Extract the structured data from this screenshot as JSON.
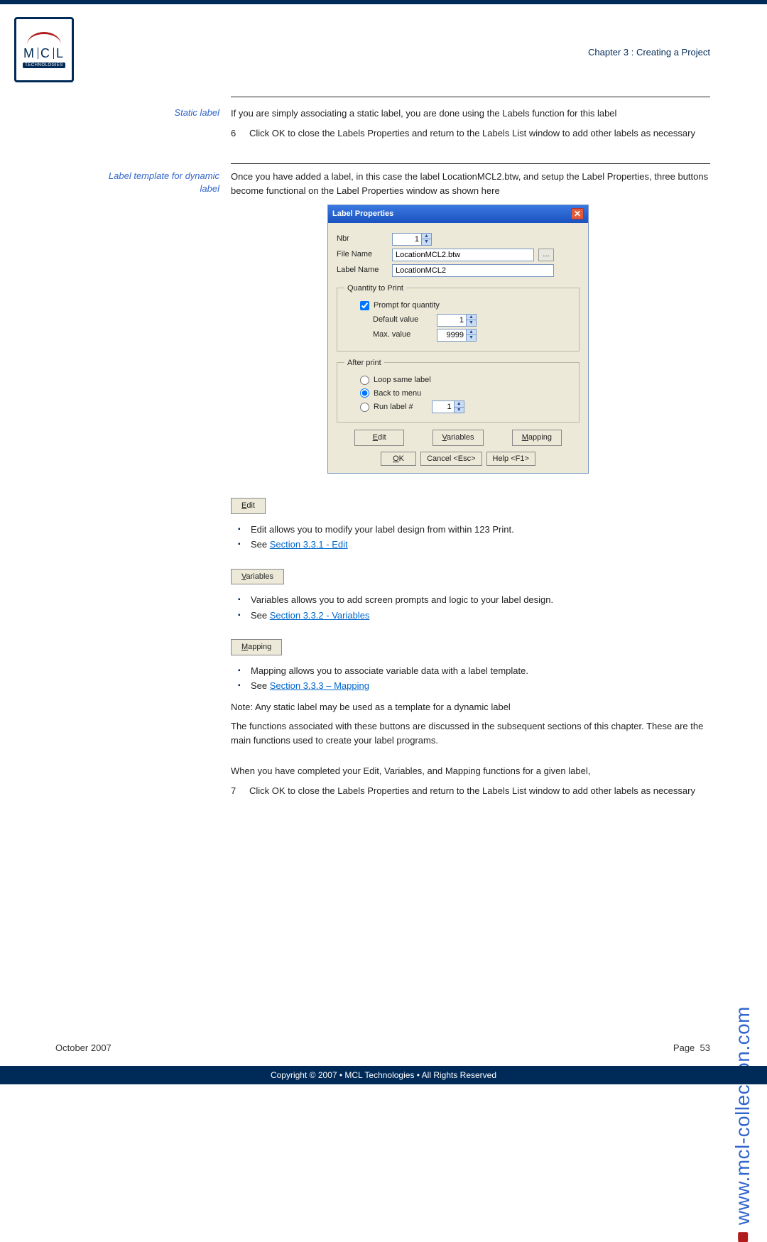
{
  "header": {
    "chapter": "Chapter 3 : Creating a Project"
  },
  "logo": {
    "letters": "M C L",
    "sub": "TECHNOLOGIES"
  },
  "section1": {
    "label": "Static label",
    "p1": "If you are simply associating a static label, you are done using the Labels function for this label",
    "step_n": "6",
    "step_t": "Click OK to close the Labels Properties and return to the Labels List window to add other labels as necessary"
  },
  "section2": {
    "label": "Label template for dynamic label",
    "p1": "Once you have added a label, in this case the label LocationMCL2.btw, and setup the Label Properties, three buttons become functional on the Label Properties window as shown here"
  },
  "dialog": {
    "title": "Label Properties",
    "nbr_label": "Nbr",
    "nbr_value": "1",
    "file_label": "File Name",
    "file_value": "LocationMCL2.btw",
    "labelname_label": "Label Name",
    "labelname_value": "LocationMCL2",
    "qty_legend": "Quantity to Print",
    "prompt_cb": "Prompt for quantity",
    "default_label": "Default value",
    "default_value": "1",
    "max_label": "Max. value",
    "max_value": "9999",
    "after_legend": "After print",
    "opt_loop": "Loop same label",
    "opt_back": "Back to menu",
    "opt_run": "Run label #",
    "run_value": "1",
    "btn_edit": "Edit",
    "btn_vars": "Variables",
    "btn_map": "Mapping",
    "btn_ok": "OK",
    "btn_cancel": "Cancel <Esc>",
    "btn_help": "Help <F1>"
  },
  "buttons_desc": {
    "edit_btn": "Edit",
    "edit_b1": "Edit allows you to modify your label design from within 123 Print.",
    "edit_b2_pre": "See ",
    "edit_b2_link": "Section 3.3.1 - Edit",
    "vars_btn": "Variables",
    "vars_b1": "Variables allows you to add screen prompts and logic to your label design.",
    "vars_b2_pre": "See ",
    "vars_b2_link": "Section 3.3.2 - Variables",
    "map_btn": "Mapping",
    "map_b1": "Mapping allows you to associate variable data with a label template.",
    "map_b2_pre": "See ",
    "map_b2_link": "Section 3.3.3 – Mapping"
  },
  "notes": {
    "p1": "Note: Any static label may be used as a template for a dynamic label",
    "p2": "The functions associated with these buttons are discussed in the subsequent sections of this chapter. These are the main functions used to create your label programs.",
    "p3": "When you have completed your Edit, Variables, and Mapping functions for a given label,",
    "step_n": "7",
    "step_t": "Click OK to close the Labels Properties and return to the Labels List window to add other labels as necessary"
  },
  "footer": {
    "date": "October 2007",
    "page_label": "Page",
    "page_num": "53",
    "copyright": "Copyright © 2007 • MCL Technologies • All Rights Reserved"
  },
  "side_url": "www.mcl-collection.com"
}
